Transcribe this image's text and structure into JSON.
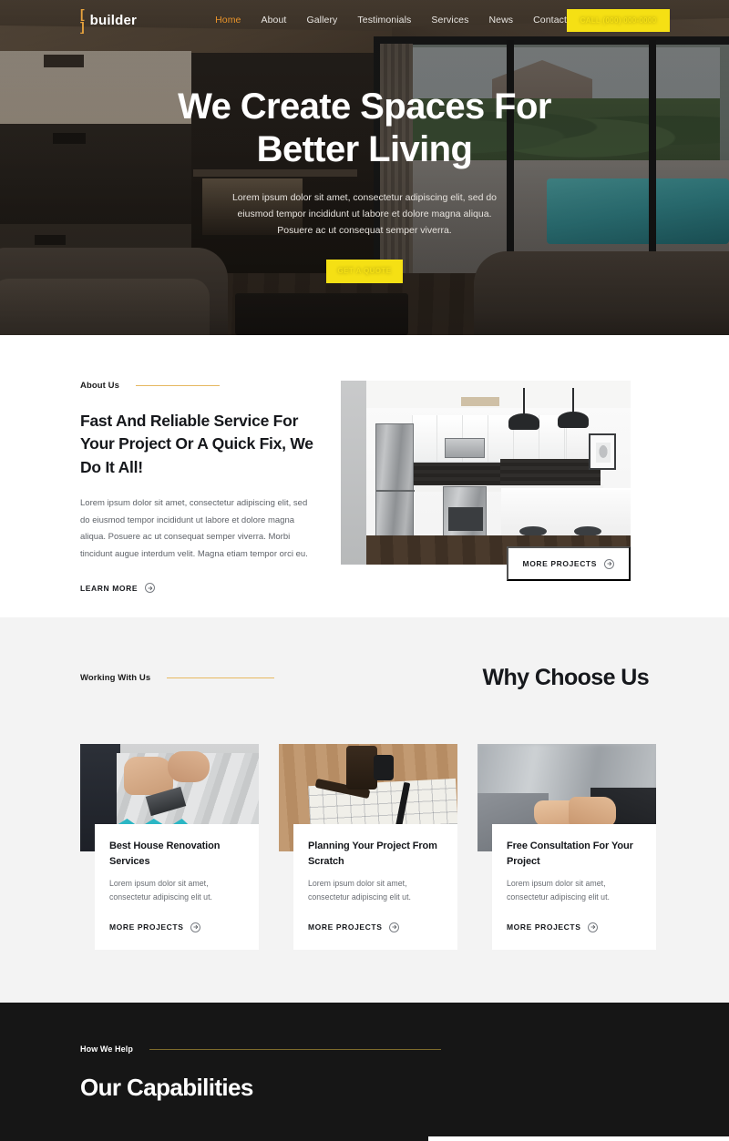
{
  "brand": {
    "mark": "[ ]",
    "name": "builder"
  },
  "nav": {
    "items": [
      {
        "label": "Home",
        "active": true
      },
      {
        "label": "About",
        "active": false
      },
      {
        "label": "Gallery",
        "active": false
      },
      {
        "label": "Testimonials",
        "active": false
      },
      {
        "label": "Services",
        "active": false
      },
      {
        "label": "News",
        "active": false
      },
      {
        "label": "Contact",
        "active": false
      }
    ],
    "cta_label": "CALL (000) 000-0000"
  },
  "hero": {
    "heading": "We Create Spaces For Better Living",
    "subheading": "Lorem ipsum dolor sit amet, consectetur adipiscing elit, sed do eiusmod tempor incididunt ut labore et dolore magna aliqua. Posuere ac ut consequat semper viverra.",
    "button_label": "GET A QUOTE"
  },
  "about": {
    "eyebrow": "About Us",
    "heading": "Fast And Reliable Service For Your Project Or A Quick Fix, We Do It All!",
    "body": "Lorem ipsum dolor sit amet, consectetur adipiscing elit, sed do eiusmod tempor incididunt ut labore et dolore magna aliqua. Posuere ac ut consequat semper viverra. Morbi tincidunt augue interdum velit. Magna etiam tempor orci eu.",
    "learn_more_label": "LEARN MORE",
    "image_caption": "Modern white kitchen with stainless steel appliances, pendant lights and island with stools",
    "more_projects_label": "MORE PROJECTS"
  },
  "why": {
    "eyebrow": "Working With Us",
    "title": "Why Choose Us",
    "cards": [
      {
        "title": "Best House Renovation Services",
        "body": "Lorem ipsum dolor sit amet, consectetur adipiscing elit ut.",
        "link_label": "MORE PROJECTS",
        "image_caption": "Worker installing laminate flooring planks"
      },
      {
        "title": "Planning Your Project From Scratch",
        "body": "Lorem ipsum dolor sit amet, consectetur adipiscing elit ut.",
        "link_label": "MORE PROJECTS",
        "image_caption": "Hammer, pen and blueprints on a wooden table"
      },
      {
        "title": "Free Consultation For Your Project",
        "body": "Lorem ipsum dolor sit amet, consectetur adipiscing elit ut.",
        "link_label": "MORE PROJECTS",
        "image_caption": "Two people in suits shaking hands"
      }
    ]
  },
  "capabilities": {
    "eyebrow": "How We Help",
    "title": "Our Capabilities"
  },
  "icons": {
    "arrow_circle": "›"
  },
  "colors": {
    "accent_yellow": "#f5e014",
    "accent_orange": "#e8932a",
    "gold_rule": "#e6b861",
    "dark_section": "#161616",
    "gray_section": "#f3f3f3",
    "heading": "#16181c",
    "body_text": "#5f6369"
  }
}
